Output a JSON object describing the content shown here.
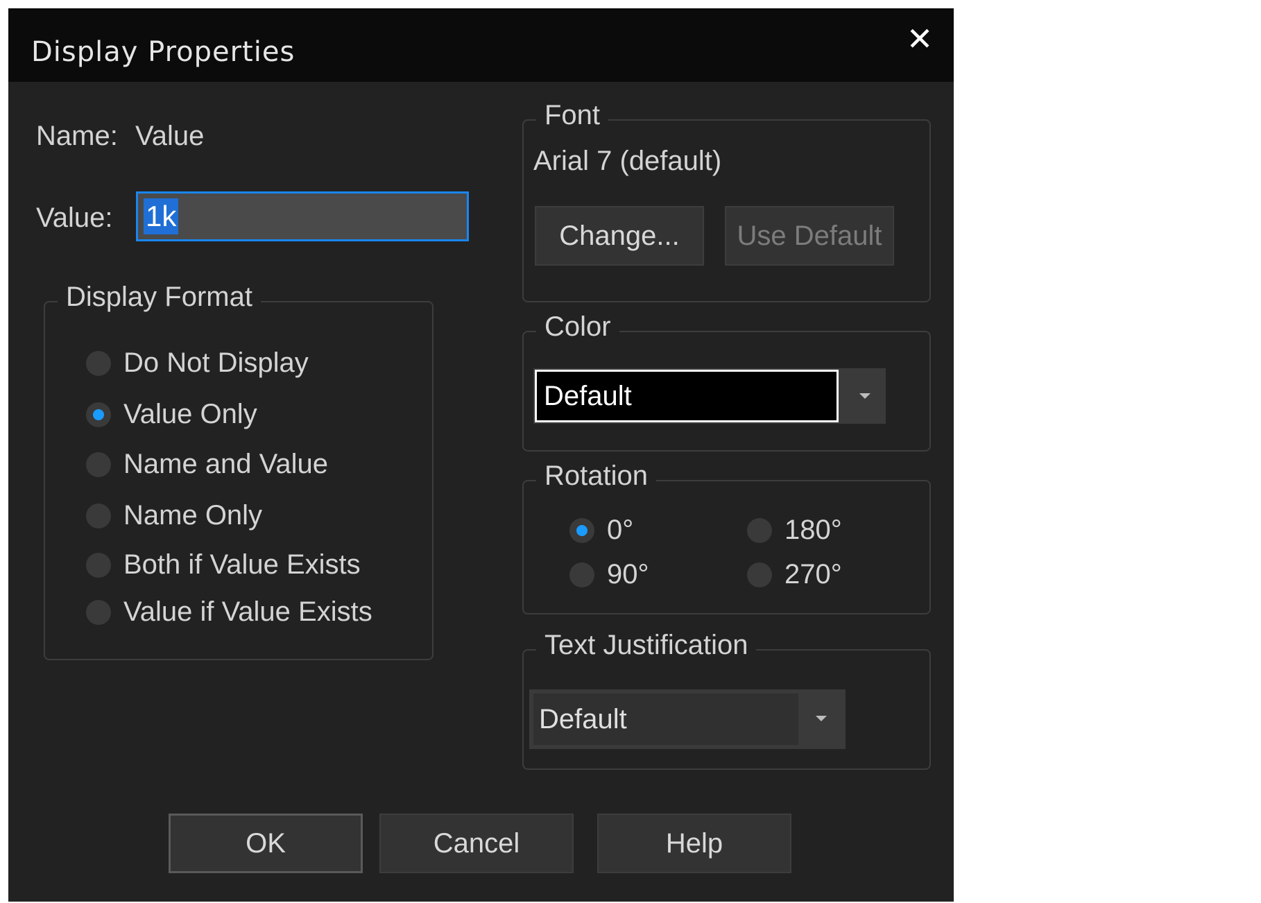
{
  "dialog": {
    "title": "Display Properties",
    "close_glyph": "✕"
  },
  "name_row": {
    "label": "Name:",
    "value": "Value"
  },
  "value_row": {
    "label": "Value:",
    "value": "1k"
  },
  "display_format": {
    "legend": "Display Format",
    "options": [
      {
        "label": "Do Not Display",
        "selected": false
      },
      {
        "label": "Value Only",
        "selected": true
      },
      {
        "label": "Name and Value",
        "selected": false
      },
      {
        "label": "Name Only",
        "selected": false
      },
      {
        "label": "Both if Value Exists",
        "selected": false
      },
      {
        "label": "Value if Value Exists",
        "selected": false
      }
    ]
  },
  "font": {
    "legend": "Font",
    "current": "Arial 7 (default)",
    "change_label": "Change...",
    "use_default_label": "Use Default"
  },
  "color": {
    "legend": "Color",
    "selected": "Default",
    "swatch": "#000000"
  },
  "rotation": {
    "legend": "Rotation",
    "options": [
      {
        "label": "0°",
        "selected": true
      },
      {
        "label": "180°",
        "selected": false
      },
      {
        "label": "90°",
        "selected": false
      },
      {
        "label": "270°",
        "selected": false
      }
    ]
  },
  "text_justification": {
    "legend": "Text Justification",
    "selected": "Default"
  },
  "buttons": {
    "ok": "OK",
    "cancel": "Cancel",
    "help": "Help"
  },
  "colors": {
    "accent": "#1a86f0",
    "dialog_bg": "#222222",
    "titlebar_bg": "#0b0b0b"
  }
}
